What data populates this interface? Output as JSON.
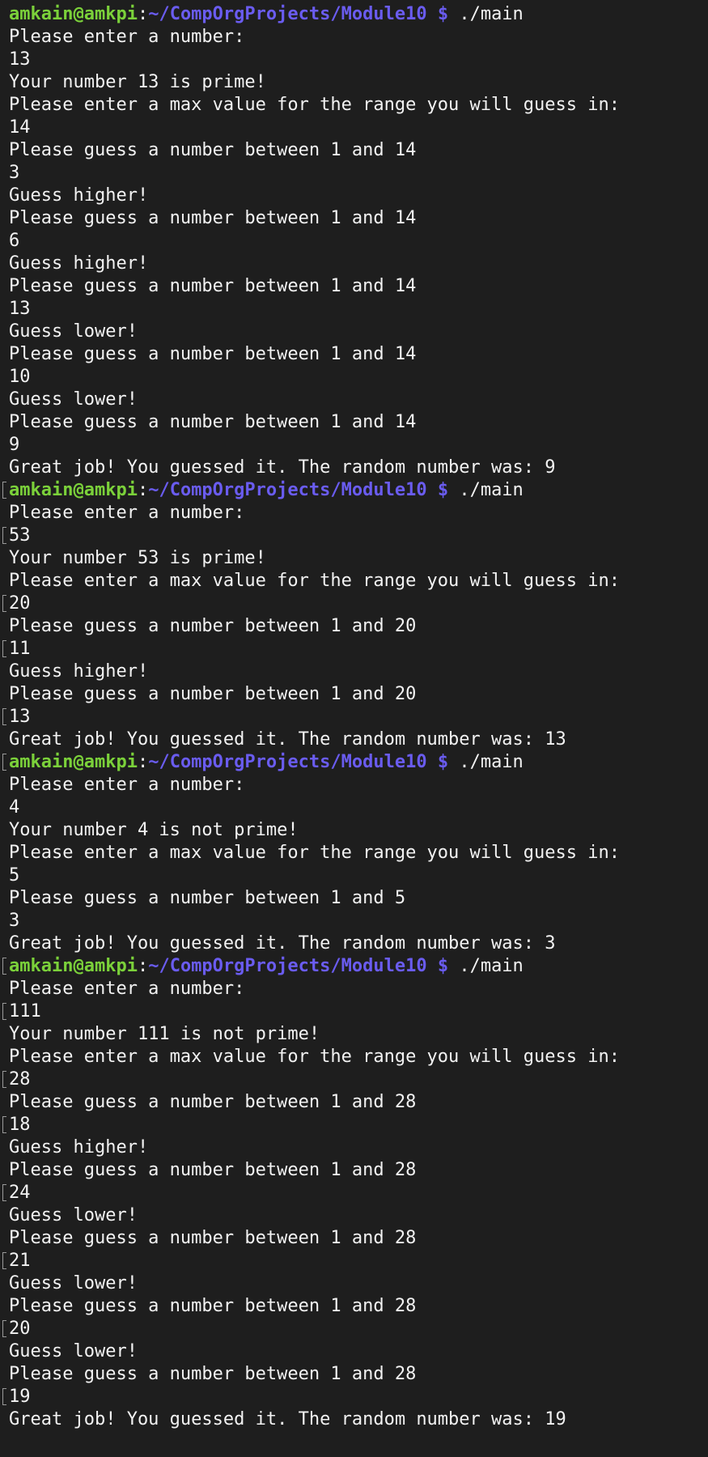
{
  "colors": {
    "background": "#1e1e1e",
    "text": "#f2f2f2",
    "prompt_user": "#7bd13a",
    "prompt_path": "#6a5cf0",
    "marker": "#9a9a9a"
  },
  "lines": [
    {
      "type": "prompt",
      "user": "amkain@amkpi",
      "path": "~/CompOrgProjects/Module10",
      "dollar": "$",
      "cmd": "./main",
      "marker": false
    },
    {
      "type": "output",
      "text": "Please enter a number:",
      "marker": false
    },
    {
      "type": "output",
      "text": "13",
      "marker": false
    },
    {
      "type": "output",
      "text": "Your number 13 is prime!",
      "marker": false
    },
    {
      "type": "output",
      "text": "Please enter a max value for the range you will guess in:",
      "marker": false
    },
    {
      "type": "output",
      "text": "14",
      "marker": false
    },
    {
      "type": "output",
      "text": "Please guess a number between 1 and 14",
      "marker": false
    },
    {
      "type": "output",
      "text": "3",
      "marker": false
    },
    {
      "type": "output",
      "text": "Guess higher!",
      "marker": false
    },
    {
      "type": "output",
      "text": "Please guess a number between 1 and 14",
      "marker": false
    },
    {
      "type": "output",
      "text": "6",
      "marker": false
    },
    {
      "type": "output",
      "text": "Guess higher!",
      "marker": false
    },
    {
      "type": "output",
      "text": "Please guess a number between 1 and 14",
      "marker": false
    },
    {
      "type": "output",
      "text": "13",
      "marker": false
    },
    {
      "type": "output",
      "text": "Guess lower!",
      "marker": false
    },
    {
      "type": "output",
      "text": "Please guess a number between 1 and 14",
      "marker": false
    },
    {
      "type": "output",
      "text": "10",
      "marker": false
    },
    {
      "type": "output",
      "text": "Guess lower!",
      "marker": false
    },
    {
      "type": "output",
      "text": "Please guess a number between 1 and 14",
      "marker": false
    },
    {
      "type": "output",
      "text": "9",
      "marker": false
    },
    {
      "type": "output",
      "text": "Great job! You guessed it. The random number was: 9",
      "marker": false
    },
    {
      "type": "prompt",
      "user": "amkain@amkpi",
      "path": "~/CompOrgProjects/Module10",
      "dollar": "$",
      "cmd": "./main",
      "marker": true
    },
    {
      "type": "output",
      "text": "Please enter a number:",
      "marker": false
    },
    {
      "type": "output",
      "text": "53",
      "marker": true
    },
    {
      "type": "output",
      "text": "Your number 53 is prime!",
      "marker": false
    },
    {
      "type": "output",
      "text": "Please enter a max value for the range you will guess in:",
      "marker": false
    },
    {
      "type": "output",
      "text": "20",
      "marker": true
    },
    {
      "type": "output",
      "text": "Please guess a number between 1 and 20",
      "marker": false
    },
    {
      "type": "output",
      "text": "11",
      "marker": true
    },
    {
      "type": "output",
      "text": "Guess higher!",
      "marker": false
    },
    {
      "type": "output",
      "text": "Please guess a number between 1 and 20",
      "marker": false
    },
    {
      "type": "output",
      "text": "13",
      "marker": true
    },
    {
      "type": "output",
      "text": "Great job! You guessed it. The random number was: 13",
      "marker": false
    },
    {
      "type": "prompt",
      "user": "amkain@amkpi",
      "path": "~/CompOrgProjects/Module10",
      "dollar": "$",
      "cmd": "./main",
      "marker": true
    },
    {
      "type": "output",
      "text": "Please enter a number:",
      "marker": false
    },
    {
      "type": "output",
      "text": "4",
      "marker": false
    },
    {
      "type": "output",
      "text": "Your number 4 is not prime!",
      "marker": false
    },
    {
      "type": "output",
      "text": "Please enter a max value for the range you will guess in:",
      "marker": false
    },
    {
      "type": "output",
      "text": "5",
      "marker": false
    },
    {
      "type": "output",
      "text": "Please guess a number between 1 and 5",
      "marker": false
    },
    {
      "type": "output",
      "text": "3",
      "marker": false
    },
    {
      "type": "output",
      "text": "Great job! You guessed it. The random number was: 3",
      "marker": false
    },
    {
      "type": "prompt",
      "user": "amkain@amkpi",
      "path": "~/CompOrgProjects/Module10",
      "dollar": "$",
      "cmd": "./main",
      "marker": true
    },
    {
      "type": "output",
      "text": "Please enter a number:",
      "marker": false
    },
    {
      "type": "output",
      "text": "111",
      "marker": true
    },
    {
      "type": "output",
      "text": "Your number 111 is not prime!",
      "marker": false
    },
    {
      "type": "output",
      "text": "Please enter a max value for the range you will guess in:",
      "marker": false
    },
    {
      "type": "output",
      "text": "28",
      "marker": true
    },
    {
      "type": "output",
      "text": "Please guess a number between 1 and 28",
      "marker": false
    },
    {
      "type": "output",
      "text": "18",
      "marker": true
    },
    {
      "type": "output",
      "text": "Guess higher!",
      "marker": false
    },
    {
      "type": "output",
      "text": "Please guess a number between 1 and 28",
      "marker": false
    },
    {
      "type": "output",
      "text": "24",
      "marker": true
    },
    {
      "type": "output",
      "text": "Guess lower!",
      "marker": false
    },
    {
      "type": "output",
      "text": "Please guess a number between 1 and 28",
      "marker": false
    },
    {
      "type": "output",
      "text": "21",
      "marker": true
    },
    {
      "type": "output",
      "text": "Guess lower!",
      "marker": false
    },
    {
      "type": "output",
      "text": "Please guess a number between 1 and 28",
      "marker": false
    },
    {
      "type": "output",
      "text": "20",
      "marker": true
    },
    {
      "type": "output",
      "text": "Guess lower!",
      "marker": false
    },
    {
      "type": "output",
      "text": "Please guess a number between 1 and 28",
      "marker": false
    },
    {
      "type": "output",
      "text": "19",
      "marker": true
    },
    {
      "type": "output",
      "text": "Great job! You guessed it. The random number was: 19",
      "marker": false
    }
  ]
}
